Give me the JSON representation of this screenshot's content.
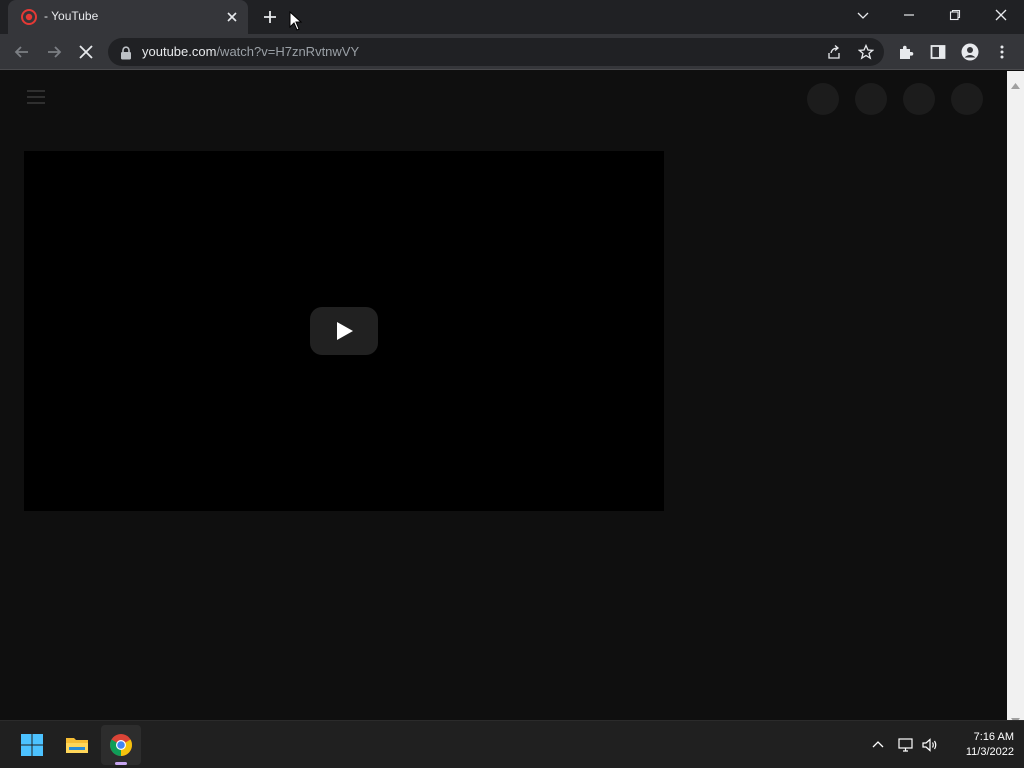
{
  "browser": {
    "tab": {
      "title": "- YouTube",
      "favicon": "youtube-favicon-icon"
    },
    "address": {
      "host": "youtube.com",
      "path": "/watch?v=H7znRvtnwVY"
    },
    "accent_color": "#35363a"
  },
  "player": {
    "play_icon": "play-icon"
  },
  "taskbar": {
    "apps": [
      "windows-start-icon",
      "file-explorer-icon",
      "chrome-icon"
    ],
    "clock": {
      "time": "7:16 AM",
      "date": "11/3/2022"
    }
  },
  "colors": {
    "background": "#0f0f0f",
    "player": "#000000",
    "taskbar": "#202020"
  }
}
